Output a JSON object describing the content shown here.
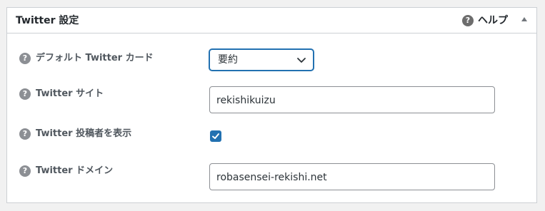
{
  "panel": {
    "title": "Twitter 設定",
    "help_label": "ヘルプ",
    "help_icon": "question-circle-icon",
    "toggle_icon": "triangle-up-icon"
  },
  "fields": {
    "card_type": {
      "label": "デフォルト Twitter カード",
      "value": "要約"
    },
    "site": {
      "label": "Twitter サイト",
      "value": "rekishikuizu"
    },
    "show_author": {
      "label": "Twitter 投稿者を表示",
      "checked": true
    },
    "domain": {
      "label": "Twitter ドメイン",
      "value": "robasensei-rekishi.net"
    }
  },
  "colors": {
    "accent": "#2271b1",
    "help_icon": "#6d6d6d",
    "question_icon": "#8c8f94"
  }
}
